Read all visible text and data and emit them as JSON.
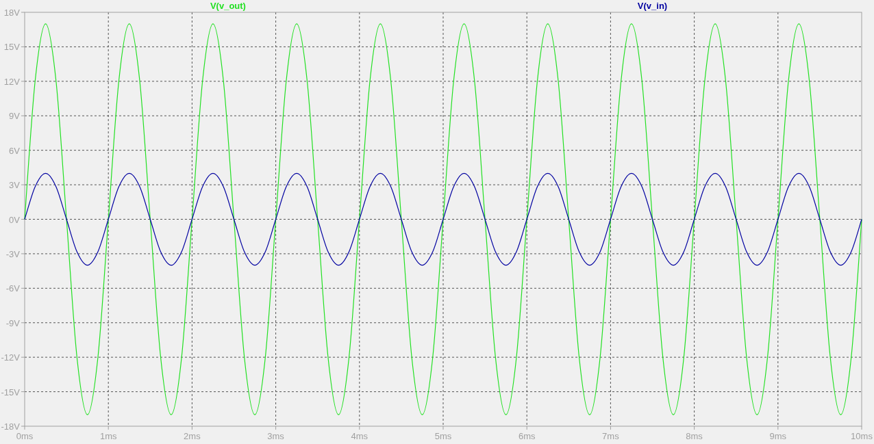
{
  "plot": {
    "chart_data": {
      "type": "line",
      "grid": true,
      "x": [
        0,
        0.125,
        0.25,
        0.375,
        0.5,
        0.625,
        0.75,
        0.875,
        1,
        1.125,
        1.25,
        1.375,
        1.5,
        1.625,
        1.75,
        1.875,
        2,
        2.125,
        2.25,
        2.375,
        2.5,
        2.625,
        2.75,
        2.875,
        3,
        3.125,
        3.25,
        3.375,
        3.5,
        3.625,
        3.75,
        3.875,
        4,
        4.125,
        4.25,
        4.375,
        4.5,
        4.625,
        4.75,
        4.875,
        5,
        5.125,
        5.25,
        5.375,
        5.5,
        5.625,
        5.75,
        5.875,
        6,
        6.125,
        6.25,
        6.375,
        6.5,
        6.625,
        6.75,
        6.875,
        7,
        7.125,
        7.25,
        7.375,
        7.5,
        7.625,
        7.75,
        7.875,
        8,
        8.125,
        8.25,
        8.375,
        8.5,
        8.625,
        8.75,
        8.875,
        9,
        9.125,
        9.25,
        9.375,
        9.5,
        9.625,
        9.75,
        9.875,
        10
      ],
      "series": [
        {
          "name": "V(v_out)",
          "color": "#22e022",
          "values": [
            0,
            12.02,
            17,
            12.02,
            0,
            -12.02,
            -17,
            -12.02,
            0,
            12.02,
            17,
            12.02,
            0,
            -12.02,
            -17,
            -12.02,
            0,
            12.02,
            17,
            12.02,
            0,
            -12.02,
            -17,
            -12.02,
            0,
            12.02,
            17,
            12.02,
            0,
            -12.02,
            -17,
            -12.02,
            0,
            12.02,
            17,
            12.02,
            0,
            -12.02,
            -17,
            -12.02,
            0,
            12.02,
            17,
            12.02,
            0,
            -12.02,
            -17,
            -12.02,
            0,
            12.02,
            17,
            12.02,
            0,
            -12.02,
            -17,
            -12.02,
            0,
            12.02,
            17,
            12.02,
            0,
            -12.02,
            -17,
            -12.02,
            0,
            12.02,
            17,
            12.02,
            0,
            -12.02,
            -17,
            -12.02,
            0,
            12.02,
            17,
            12.02,
            0,
            -12.02,
            -17,
            -12.02,
            0
          ]
        },
        {
          "name": "V(v_in)",
          "color": "#0000a0",
          "values": [
            0,
            2.83,
            4,
            2.83,
            0,
            -2.83,
            -4,
            -2.83,
            0,
            2.83,
            4,
            2.83,
            0,
            -2.83,
            -4,
            -2.83,
            0,
            2.83,
            4,
            2.83,
            0,
            -2.83,
            -4,
            -2.83,
            0,
            2.83,
            4,
            2.83,
            0,
            -2.83,
            -4,
            -2.83,
            0,
            2.83,
            4,
            2.83,
            0,
            -2.83,
            -4,
            -2.83,
            0,
            2.83,
            4,
            2.83,
            0,
            -2.83,
            -4,
            -2.83,
            0,
            2.83,
            4,
            2.83,
            0,
            -2.83,
            -4,
            -2.83,
            0,
            2.83,
            4,
            2.83,
            0,
            -2.83,
            -4,
            -2.83,
            0,
            2.83,
            4,
            2.83,
            0,
            -2.83,
            -4,
            -2.83,
            0,
            2.83,
            4,
            2.83,
            0,
            -2.83,
            -4,
            -2.83,
            0
          ]
        }
      ],
      "xlim": [
        0,
        10
      ],
      "ylim": [
        -18,
        18
      ],
      "xticks": [
        {
          "value": 0,
          "label": "0ms"
        },
        {
          "value": 1,
          "label": "1ms"
        },
        {
          "value": 2,
          "label": "2ms"
        },
        {
          "value": 3,
          "label": "3ms"
        },
        {
          "value": 4,
          "label": "4ms"
        },
        {
          "value": 5,
          "label": "5ms"
        },
        {
          "value": 6,
          "label": "6ms"
        },
        {
          "value": 7,
          "label": "7ms"
        },
        {
          "value": 8,
          "label": "8ms"
        },
        {
          "value": 9,
          "label": "9ms"
        },
        {
          "value": 10,
          "label": "10ms"
        }
      ],
      "yticks": [
        {
          "value": -18,
          "label": "-18V"
        },
        {
          "value": -15,
          "label": "-15V"
        },
        {
          "value": -12,
          "label": "-12V"
        },
        {
          "value": -9,
          "label": "-9V"
        },
        {
          "value": -6,
          "label": "-6V"
        },
        {
          "value": -3,
          "label": "-3V"
        },
        {
          "value": 0,
          "label": "0V"
        },
        {
          "value": 3,
          "label": "3V"
        },
        {
          "value": 6,
          "label": "6V"
        },
        {
          "value": 9,
          "label": "9V"
        },
        {
          "value": 12,
          "label": "12V"
        },
        {
          "value": 15,
          "label": "15V"
        },
        {
          "value": 18,
          "label": "18V"
        }
      ]
    }
  }
}
